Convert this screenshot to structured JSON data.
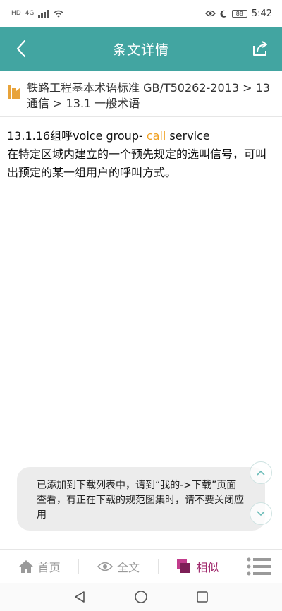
{
  "status_bar": {
    "left_small": "HD",
    "net": "4G",
    "battery": "88",
    "time": "5:42"
  },
  "header": {
    "title": "条文详情"
  },
  "breadcrumb": {
    "book": "铁路工程基本术语标准 GB/T50262-2013",
    "sep1": " > ",
    "chapter": "13 通信",
    "sep2": " > ",
    "section": "13.1 一般术语"
  },
  "article": {
    "term_prefix": "13.1.16组呼voice group- ",
    "term_highlight": "call",
    "term_suffix": " service",
    "definition": "在特定区域内建立的一个预先规定的选叫信号，可叫出预定的某一组用户的呼叫方式。"
  },
  "toast": {
    "message": "已添加到下载列表中，请到“我的->下载”页面查看，有正在下载的规范图集时，请不要关闭应用"
  },
  "bottom_nav": {
    "home": "首页",
    "fulltext": "全文",
    "similar": "相似"
  },
  "colors": {
    "header_bg": "#42a5a1",
    "highlight": "#f0a020",
    "active_tab": "#a0286c",
    "book_icon": "#e8a33a"
  }
}
